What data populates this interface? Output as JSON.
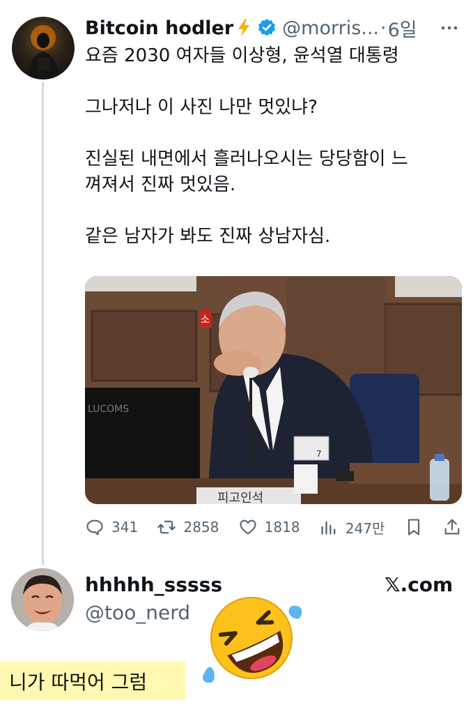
{
  "tweet": {
    "display_name": "Bitcoin hodler",
    "handle": "@morris...",
    "separator": "·",
    "time": "6일",
    "text_lines": [
      "요즘 2030 여자들 이상형, 윤석열 대통령",
      "",
      "그나저나 이 사진 나만 멋있냐?",
      "",
      "진실된 내면에서 흘러나오시는 당당함이 느",
      "껴져서 진짜 멋있음.",
      "",
      "같은 남자가 봐도 진짜 상남자심."
    ],
    "media_visible_text": {
      "monitor_brand": "LUCOMS",
      "sign_fragment": "소",
      "badge_number": "7",
      "nameplate": "피고인석"
    },
    "actions": {
      "replies": "341",
      "retweets": "2858",
      "likes": "1818",
      "views": "247만"
    }
  },
  "reply": {
    "display_name": "hhhhh_sssss",
    "handle": "@too_nerd",
    "brand": "𝕏.com"
  },
  "caption": "니가 따먹어 그럼",
  "colors": {
    "text": "#0f1419",
    "muted": "#536471",
    "verified": "#1d9bf0",
    "bolt": "#f4b400",
    "caption_bg": "#fef8b0",
    "thread_line": "#cfd9de"
  }
}
